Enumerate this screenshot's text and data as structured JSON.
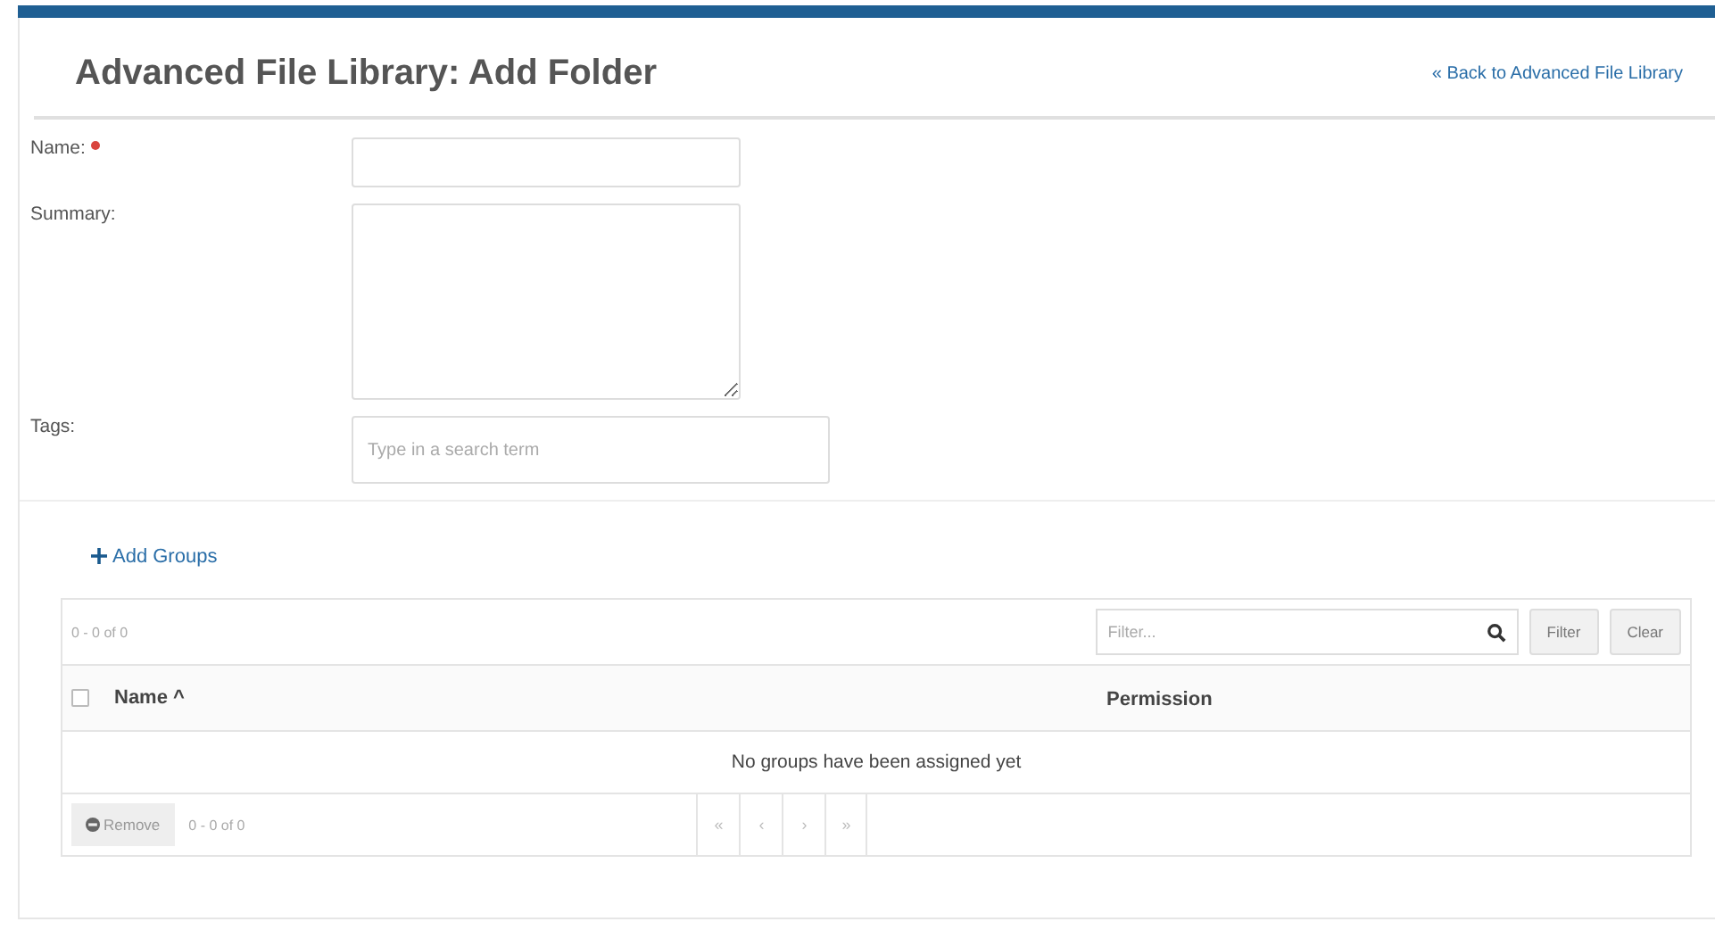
{
  "header": {
    "title": "Advanced File Library: Add Folder",
    "back_link": "« Back to Advanced File Library"
  },
  "form": {
    "fields": [
      {
        "kind": "input",
        "label": "Name:",
        "required": true
      },
      {
        "kind": "textarea",
        "label": "Summary:",
        "required": false
      },
      {
        "kind": "tags",
        "label": "Tags:",
        "required": false,
        "placeholder": "Type in a search term"
      }
    ]
  },
  "groups": {
    "add_label": "Add Groups",
    "range_top": "0 - 0 of 0",
    "filter": {
      "placeholder": "Filter...",
      "buttons": [
        "Filter",
        "Clear"
      ]
    },
    "table": {
      "select_all": {
        "checked": false
      },
      "columns": [
        {
          "label": "Name",
          "sort": "^"
        },
        {
          "label": "Permission"
        }
      ],
      "empty_message": "No groups have been assigned yet"
    },
    "footer": {
      "remove": {
        "label": "Remove",
        "disabled": true
      },
      "range": "0 - 0 of 0",
      "pager": [
        {
          "label": "«",
          "disabled": true
        },
        {
          "label": "‹",
          "disabled": true
        },
        {
          "label": "›",
          "disabled": true
        },
        {
          "label": "»",
          "disabled": true
        }
      ]
    }
  }
}
